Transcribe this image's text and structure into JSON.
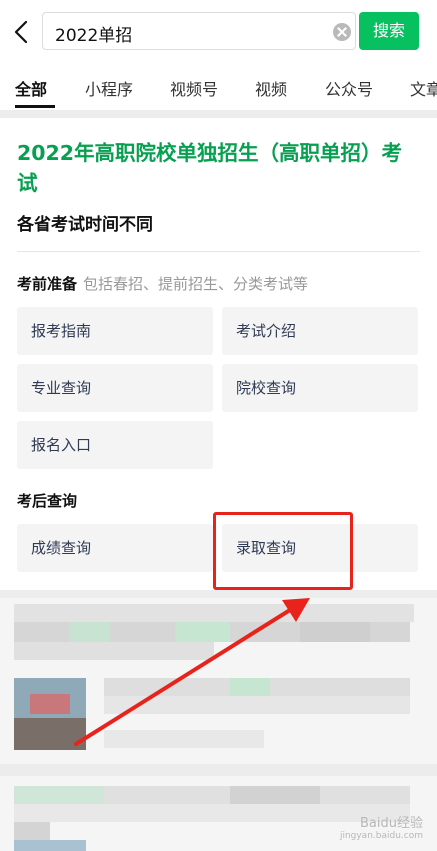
{
  "search": {
    "query": "2022单招",
    "button": "搜索"
  },
  "tabs": [
    "全部",
    "小程序",
    "视频号",
    "视频",
    "公众号",
    "文章"
  ],
  "card": {
    "title": "2022年高职院校单独招生（高职单招）考试",
    "subtitle": "各省考试时间不同",
    "pre_exam": {
      "heading": "考前准备",
      "note": "包括春招、提前招生、分类考试等",
      "buttons": [
        "报考指南",
        "考试介绍",
        "专业查询",
        "院校查询",
        "报名入口"
      ]
    },
    "post_exam": {
      "heading": "考后查询",
      "buttons": [
        "成绩查询",
        "录取查询"
      ]
    }
  },
  "colors": {
    "accent_green": "#07c160",
    "title_green": "#07a050",
    "highlight_red": "#e8231c"
  },
  "watermark": {
    "main": "Baidu经验",
    "sub": "jingyan.baidu.com"
  }
}
